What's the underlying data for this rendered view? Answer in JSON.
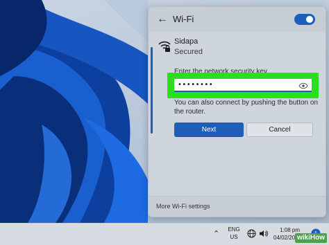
{
  "flyout": {
    "title": "Wi-Fi",
    "wifi_enabled": true
  },
  "network": {
    "name": "Sidapa",
    "status": "Secured",
    "key_label": "Enter the network security key",
    "key_value": "••••••••",
    "router_text": "You can also connect by pushing the button on the router.",
    "next_label": "Next",
    "cancel_label": "Cancel"
  },
  "footer": {
    "more_settings": "More Wi-Fi settings"
  },
  "taskbar": {
    "lang_line1": "ENG",
    "lang_line2": "US",
    "time": "1:08 pm",
    "date": "04/02/2023"
  },
  "watermark": "wikiHow",
  "colors": {
    "accent": "#1d5fb8",
    "highlight": "#29e01d"
  },
  "icons": [
    "back-arrow-icon",
    "wifi-secured-icon",
    "reveal-password-icon",
    "chevron-up-icon",
    "globe-icon",
    "speaker-icon",
    "notification-icon"
  ]
}
